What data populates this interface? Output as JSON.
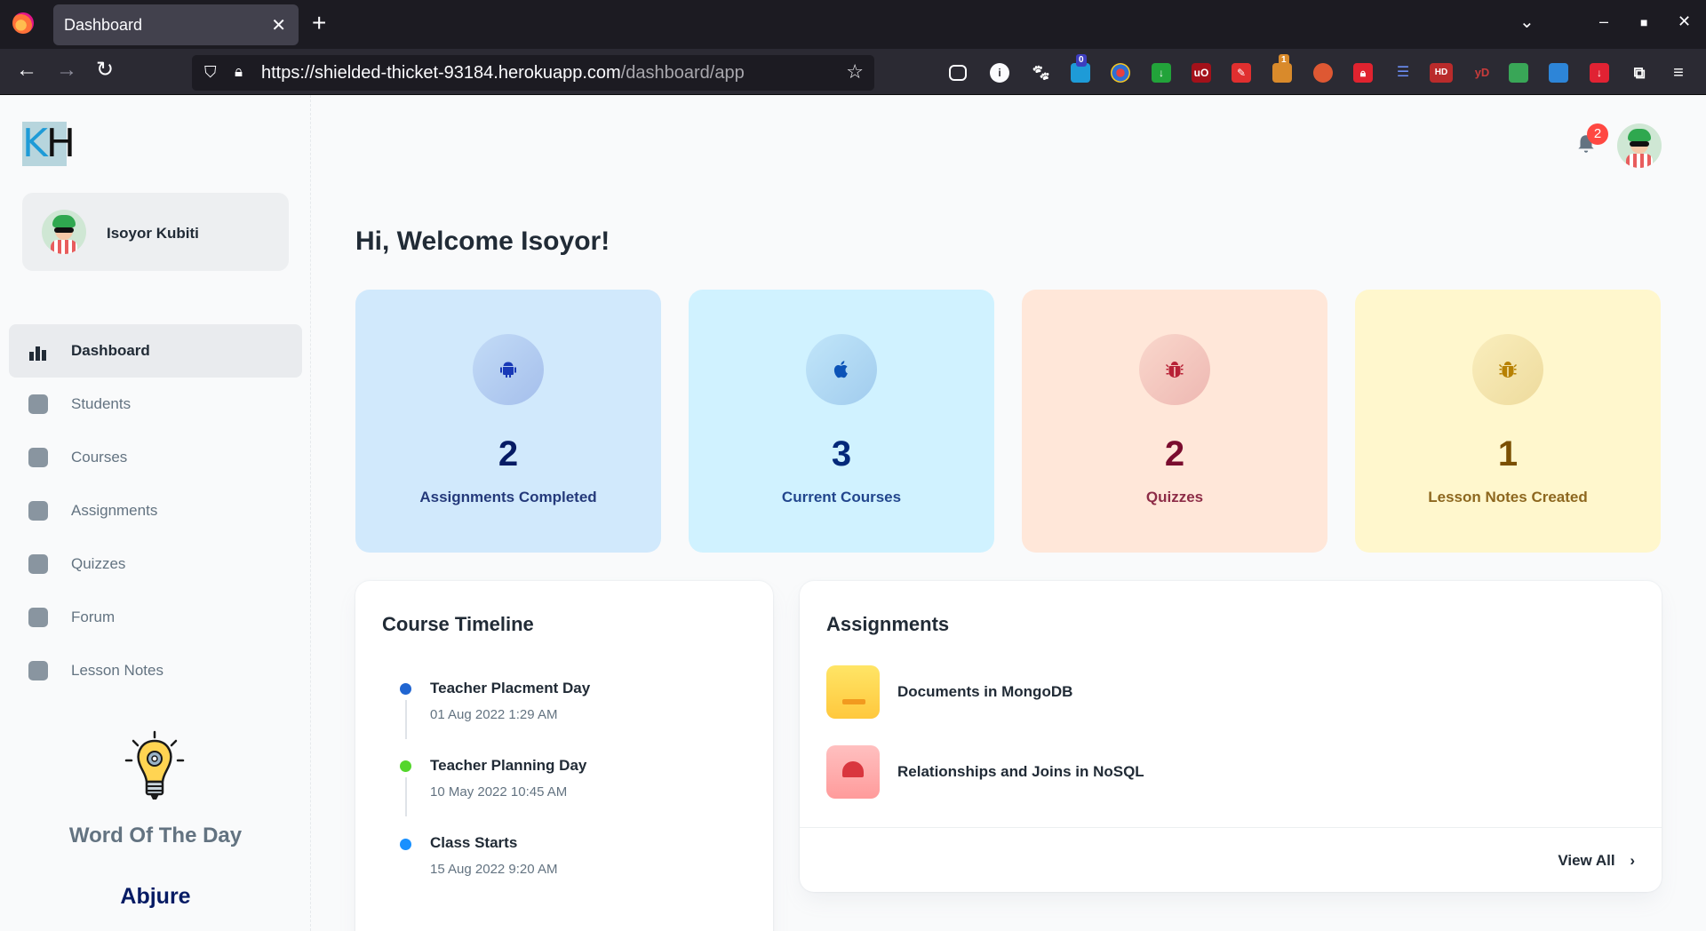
{
  "browser": {
    "tab_title": "Dashboard",
    "url_host": "https://shielded-thicket-93184.herokuapp.com",
    "url_path": "/dashboard/app",
    "ext_badge_1": "0",
    "ext_badge_2": "1",
    "ext_hd": "HD",
    "ext_yd": "yD"
  },
  "logo": {
    "k": "K",
    "h": "H"
  },
  "account": {
    "name": "Isoyor Kubiti"
  },
  "nav": {
    "items": [
      {
        "label": "Dashboard"
      },
      {
        "label": "Students"
      },
      {
        "label": "Courses"
      },
      {
        "label": "Assignments"
      },
      {
        "label": "Quizzes"
      },
      {
        "label": "Forum"
      },
      {
        "label": "Lesson Notes"
      }
    ]
  },
  "word_of_day": {
    "title": "Word Of The Day",
    "word": "Abjure"
  },
  "notifications": {
    "count": "2"
  },
  "welcome": "Hi, Welcome Isoyor!",
  "stats": [
    {
      "value": "2",
      "label": "Assignments Completed",
      "icon": "android-icon",
      "bg": "#d1e9fc",
      "fg": "#061b64",
      "accent": "#1939b7"
    },
    {
      "value": "3",
      "label": "Current Courses",
      "icon": "apple-icon",
      "bg": "#d0f2ff",
      "fg": "#04297a",
      "accent": "#0c53b7"
    },
    {
      "value": "2",
      "label": "Quizzes",
      "icon": "bug-icon",
      "bg": "#ffe7d9",
      "fg": "#7a0c2e",
      "accent": "#b72136"
    },
    {
      "value": "1",
      "label": "Lesson Notes Created",
      "icon": "bug-icon",
      "bg": "#fff7cd",
      "fg": "#7a4f01",
      "accent": "#b78103"
    }
  ],
  "timeline": {
    "title": "Course Timeline",
    "items": [
      {
        "title": "Teacher Placment Day",
        "time": "01 Aug 2022 1:29 AM",
        "color": "#2065d1"
      },
      {
        "title": "Teacher Planning Day",
        "time": "10 May 2022 10:45 AM",
        "color": "#54d62c"
      },
      {
        "title": "Class Starts",
        "time": "15 Aug 2022 9:20 AM",
        "color": "#1890ff"
      }
    ]
  },
  "assignments": {
    "title": "Assignments",
    "items": [
      {
        "title": "Documents in MongoDB"
      },
      {
        "title": "Relationships and Joins in NoSQL"
      }
    ],
    "view_all": "View All"
  }
}
